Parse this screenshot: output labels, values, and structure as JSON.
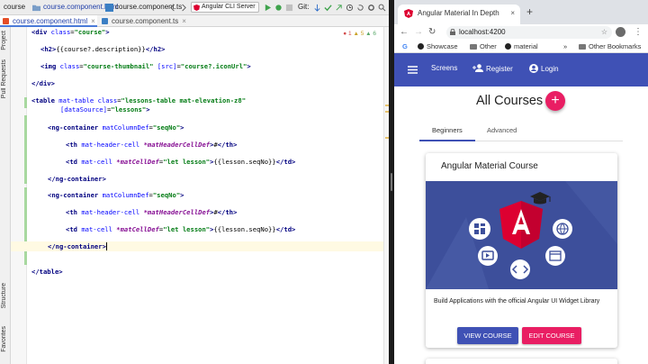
{
  "ide": {
    "project_label": "course",
    "breadcrumb_file": "course.component.html",
    "breadcrumb_ts": "course.component.ts",
    "run_config": "Angular CLI Server",
    "git_label": "Git:",
    "tabs": [
      {
        "label": "course.component.html",
        "active": true
      },
      {
        "label": "course.component.ts",
        "active": false
      }
    ],
    "left_tools": [
      "Project",
      "Pull Requests",
      "Structure",
      "Favorites"
    ],
    "inspection": {
      "errors": "1",
      "warnings": "5",
      "weak": "6"
    },
    "code_lines": [
      "<div class=\"course\">",
      "<h2>{{course?.description}}</h2>",
      "<img class=\"course-thumbnail\" [src]=\"course?.iconUrl\">",
      "</div>",
      "<table mat-table class=\"lessons-table mat-elevation-z8\"",
      "[dataSource]=\"lessons\">",
      "<ng-container matColumnDef=\"seqNo\">",
      "<th mat-header-cell *matHeaderCellDef>#</th>",
      "<td mat-cell *matCellDef=\"let lesson\">{{lesson.seqNo}}</td>",
      "</ng-container>",
      "<ng-container matColumnDef=\"seqNo\">",
      "<th mat-header-cell *matHeaderCellDef>#</th>",
      "<td mat-cell *matCellDef=\"let lesson\">{{lesson.seqNo}}</td>",
      "</ng-container>",
      "</table>"
    ]
  },
  "browser": {
    "tab_title": "Angular Material In Depth",
    "url": "localhost:4200",
    "bookmarks": [
      "Showcase",
      "Other",
      "material"
    ],
    "other_bookmarks": "Other Bookmarks",
    "chevron": "»"
  },
  "app": {
    "nav": [
      {
        "label": "Screens",
        "icon": "screens-icon"
      },
      {
        "label": "Register",
        "icon": "person-add-icon"
      },
      {
        "label": "Login",
        "icon": "account-circle-icon"
      }
    ],
    "page_title": "All Courses",
    "fab_label": "+",
    "tabs": [
      "Beginners",
      "Advanced"
    ],
    "active_tab": "Beginners",
    "card": {
      "title": "Angular Material Course",
      "description": "Build Applications with the official Angular UI Widget Library",
      "view_button": "VIEW COURSE",
      "edit_button": "EDIT COURSE"
    }
  },
  "colors": {
    "primary": "#3f51b5",
    "accent": "#e91e63",
    "angular_red": "#dd0031",
    "card_image_bg": "#3d4f9b"
  }
}
